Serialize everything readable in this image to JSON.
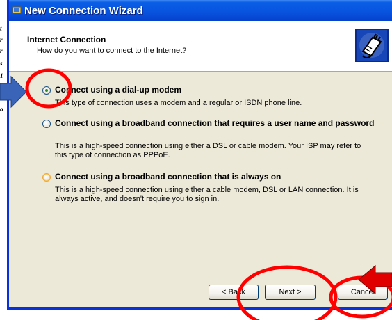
{
  "window": {
    "title": "New Connection Wizard"
  },
  "header": {
    "title": "Internet Connection",
    "subtitle": "How do you want to connect to the Internet?"
  },
  "options": [
    {
      "label": "Connect using a dial-up modem",
      "description": "This type of connection uses a modem and a regular or ISDN phone line.",
      "selected": true
    },
    {
      "label": "Connect using a broadband connection that requires a user name and password",
      "description": "This is a high-speed connection using either a DSL or cable modem. Your ISP may refer to this type of connection as PPPoE.",
      "selected": false
    },
    {
      "label": "Connect using a broadband connection that is always on",
      "description": "This is a high-speed connection using either a cable modem, DSL or LAN connection. It is always active, and doesn't require you to sign in.",
      "selected": false
    }
  ],
  "buttons": {
    "back": "< Back",
    "next": "Next >",
    "cancel": "Cancel"
  },
  "left_strip": [
    "t",
    "r",
    "r",
    "s",
    "1",
    "s",
    "o"
  ],
  "colors": {
    "titlebar": "#0854e0",
    "annotation_red": "#ff0000",
    "arrow_blue": "#1f4e9e"
  }
}
